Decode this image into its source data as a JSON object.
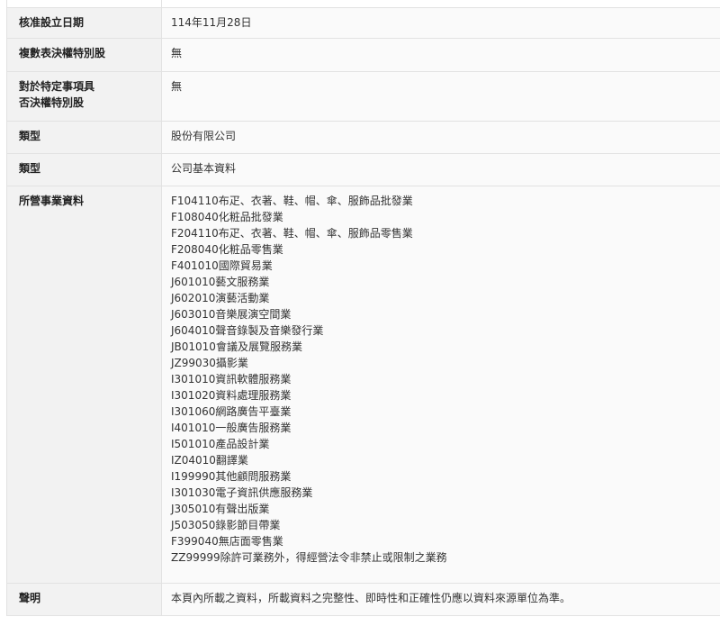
{
  "rows": {
    "approval_date": {
      "label": "核准設立日期",
      "value": "114年11月28日"
    },
    "multi_vote_shares": {
      "label": "複數表決權特別股",
      "value": "無"
    },
    "veto_shares": {
      "label_line1": "對於特定事項具",
      "label_line2": "否決權特別股",
      "value": "無"
    },
    "type1": {
      "label": "類型",
      "value": "股份有限公司"
    },
    "type2": {
      "label": "類型",
      "value": "公司基本資料"
    },
    "business": {
      "label": "所營事業資料",
      "items": [
        "F104110布疋、衣著、鞋、帽、傘、服飾品批發業",
        "F108040化粧品批發業",
        "F204110布疋、衣著、鞋、帽、傘、服飾品零售業",
        "F208040化粧品零售業",
        "F401010國際貿易業",
        "J601010藝文服務業",
        "J602010演藝活動業",
        "J603010音樂展演空間業",
        "J604010聲音錄製及音樂發行業",
        "JB01010會議及展覽服務業",
        "JZ99030攝影業",
        "I301010資訊軟體服務業",
        "I301020資料處理服務業",
        "I301060網路廣告平臺業",
        "I401010一般廣告服務業",
        "I501010產品設計業",
        "IZ04010翻譯業",
        "I199990其他顧問服務業",
        "I301030電子資訊供應服務業",
        "J305010有聲出版業",
        "J503050錄影節目帶業",
        "F399040無店面零售業",
        "ZZ99999除許可業務外，得經營法令非禁止或限制之業務"
      ]
    },
    "disclaimer": {
      "label": "聲明",
      "value": "本頁內所載之資料，所載資料之完整性、即時性和正確性仍應以資料來源單位為準。"
    }
  }
}
